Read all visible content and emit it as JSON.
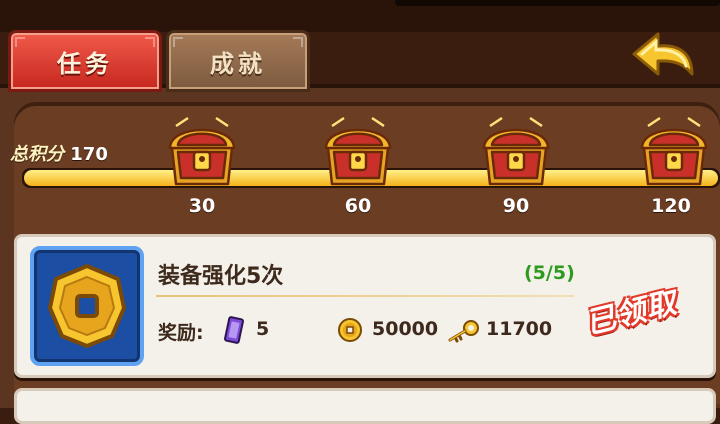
{
  "tabs": [
    {
      "label": "任务",
      "active": true
    },
    {
      "label": "成就",
      "active": false
    }
  ],
  "score": {
    "label": "总积分",
    "value": "170",
    "progress": 1.0
  },
  "milestones": [
    "30",
    "60",
    "90",
    "120"
  ],
  "task": {
    "title": "装备强化5次",
    "progress": "(5/5)",
    "reward_label": "奖励:",
    "rewards": [
      {
        "icon": "purple-card-icon",
        "value": "5"
      },
      {
        "icon": "gold-coin-icon",
        "value": "50000"
      },
      {
        "icon": "gold-key-icon",
        "value": "11700"
      }
    ],
    "status": "已领取"
  },
  "colors": {
    "tab_active": "#e0392d",
    "progress_fill": "#f5c21a",
    "task_progress": "#2e9b1f",
    "claimed_stamp": "#e23a2a",
    "icon_box": "#1c4ea4"
  }
}
